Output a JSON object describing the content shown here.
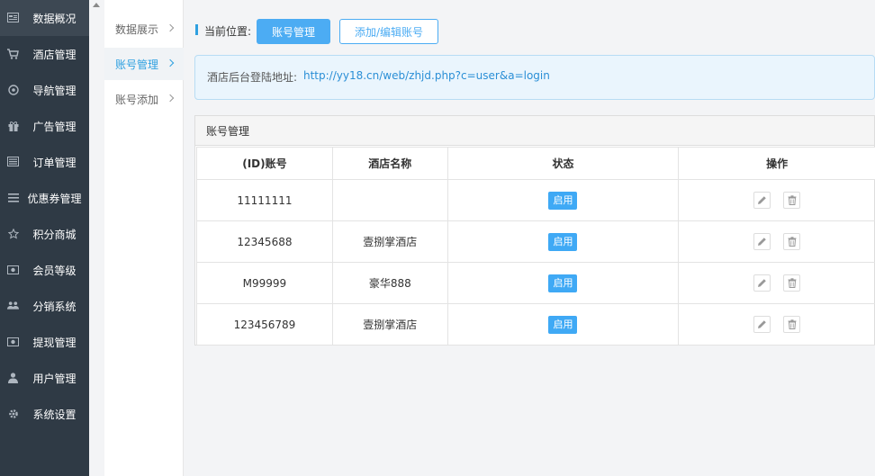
{
  "sidebar": {
    "items": [
      {
        "label": "数据概况",
        "icon": "dashboard-icon",
        "active": true
      },
      {
        "label": "酒店管理",
        "icon": "cart-icon"
      },
      {
        "label": "导航管理",
        "icon": "compass-icon"
      },
      {
        "label": "广告管理",
        "icon": "gift-icon"
      },
      {
        "label": "订单管理",
        "icon": "server-icon"
      },
      {
        "label": "优惠券管理",
        "icon": "list-icon"
      },
      {
        "label": "积分商城",
        "icon": "star-icon"
      },
      {
        "label": "会员等级",
        "icon": "money-icon"
      },
      {
        "label": "分销系统",
        "icon": "users-icon"
      },
      {
        "label": "提现管理",
        "icon": "money-icon"
      },
      {
        "label": "用户管理",
        "icon": "user-icon"
      },
      {
        "label": "系统设置",
        "icon": "gear-icon"
      }
    ]
  },
  "submenu": {
    "items": [
      {
        "label": "数据展示"
      },
      {
        "label": "账号管理",
        "active": true
      },
      {
        "label": "账号添加"
      }
    ]
  },
  "location": {
    "label": "当前位置:",
    "current": "账号管理",
    "add_edit": "添加/编辑账号"
  },
  "info": {
    "label": "酒店后台登陆地址:",
    "url": "http://yy18.cn/web/zhjd.php?c=user&a=login"
  },
  "panel": {
    "title": "账号管理",
    "columns": [
      "(ID)账号",
      "酒店名称",
      "状态",
      "操作"
    ],
    "rows": [
      {
        "account": "11111111",
        "hotel": "",
        "status": "启用"
      },
      {
        "account": "12345688",
        "hotel": "壹捌掌酒店",
        "status": "启用"
      },
      {
        "account": "M99999",
        "hotel": "豪华888",
        "status": "启用"
      },
      {
        "account": "123456789",
        "hotel": "壹捌掌酒店",
        "status": "启用"
      }
    ]
  },
  "colors": {
    "sidebar_bg": "#2f3a45",
    "accent": "#4cacf3",
    "badge": "#3fa9f5",
    "link": "#2b8fd6"
  }
}
